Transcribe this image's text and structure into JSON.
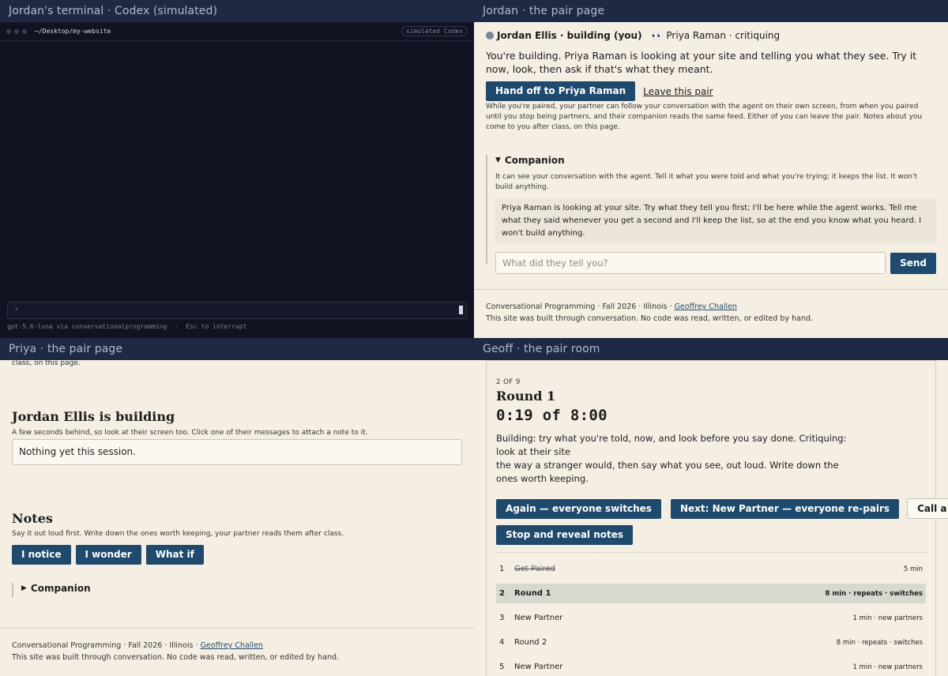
{
  "panes": {
    "terminal": {
      "title": "Jordan's terminal · Codex (simulated)",
      "path": "~/Desktop/my-website",
      "badge": "simulated Codex",
      "prompt": "›",
      "footer": "gpt-5.6-luna via conversationalprogramming  ·  Esc to interrupt"
    },
    "jordan": {
      "title": "Jordan · the pair page",
      "me": "Jordan Ellis · building (you)",
      "partner": "Priya Raman · critiquing",
      "lead": "You're building. Priya Raman is looking at your site and telling you what they see. Try it now, look, then ask if that's what they meant.",
      "handoff_button": "Hand off to Priya Raman",
      "leave_link": "Leave this pair",
      "privacy": "While you're paired, your partner can follow your conversation with the agent on their own screen, from when you paired until you stop being partners, and their companion reads the same feed. Either of you can leave the pair. Notes about you come to you after class, on this page.",
      "companion": {
        "toggle": "Companion",
        "intro": "It can see your conversation with the agent. Tell it what you were told and what you're trying; it keeps the list. It won't build anything.",
        "message": "Priya Raman is looking at your site. Try what they tell you first; I'll be here while the agent works. Tell me what they said whenever you get a second and I'll keep the list, so at the end you know what you heard. I won't build anything.",
        "placeholder": "What did they tell you?",
        "send": "Send"
      },
      "footer": {
        "line1_a": "Conversational Programming",
        "line1_b": "Fall 2026",
        "line1_c": "Illinois",
        "author": "Geoffrey Challen",
        "line2": "This site was built through conversation. No code was read, written, or edited by hand."
      }
    },
    "priya": {
      "title": "Priya · the pair page",
      "cut_text": "class, on this page.",
      "heading": "Jordan Ellis is building",
      "sub": "A few seconds behind, so look at their screen too. Click one of their messages to attach a note to it.",
      "feed_empty": "Nothing yet this session.",
      "notes_heading": "Notes",
      "notes_sub": "Say it out loud first. Write down the ones worth keeping, your partner reads them after class.",
      "note_buttons": [
        "I notice",
        "I wonder",
        "What if"
      ],
      "companion_toggle": "Companion",
      "footer": {
        "line1_a": "Conversational Programming",
        "line1_b": "Fall 2026",
        "line1_c": "Illinois",
        "author": "Geoffrey Challen",
        "line2": "This site was built through conversation. No code was read, written, or edited by hand."
      }
    },
    "geoff": {
      "title": "Geoff · the pair room",
      "step": "2 OF 9",
      "round": "Round 1",
      "timer": "0:19 of 8:00",
      "instructions_1": "Building: try what you're told, now, and look before you say done. Critiquing: look at their site",
      "instructions_2": "the way a stranger would, then say what you see, out loud. Write down the ones worth keeping.",
      "buttons": {
        "again": "Again — everyone switches",
        "next": "Next: New Partner — everyone re-pairs",
        "call": "Call a switch",
        "stop": "Stop and reveal notes"
      },
      "schedule": [
        {
          "n": "1",
          "name": "Get Paired",
          "meta": "5 min",
          "state": "done"
        },
        {
          "n": "2",
          "name": "Round 1",
          "meta": "8 min · repeats · switches",
          "state": "current"
        },
        {
          "n": "3",
          "name": "New Partner",
          "meta": "1 min · new partners",
          "state": "upcoming"
        },
        {
          "n": "4",
          "name": "Round 2",
          "meta": "8 min · repeats · switches",
          "state": "upcoming"
        },
        {
          "n": "5",
          "name": "New Partner",
          "meta": "1 min · new partners",
          "state": "upcoming"
        }
      ]
    }
  },
  "colors": {
    "title_bar": "#1e2a44",
    "paper": "#f5efe3",
    "terminal_bg": "#111322",
    "button_blue": "#1f4a6d",
    "current_row": "#d6d9cf"
  }
}
